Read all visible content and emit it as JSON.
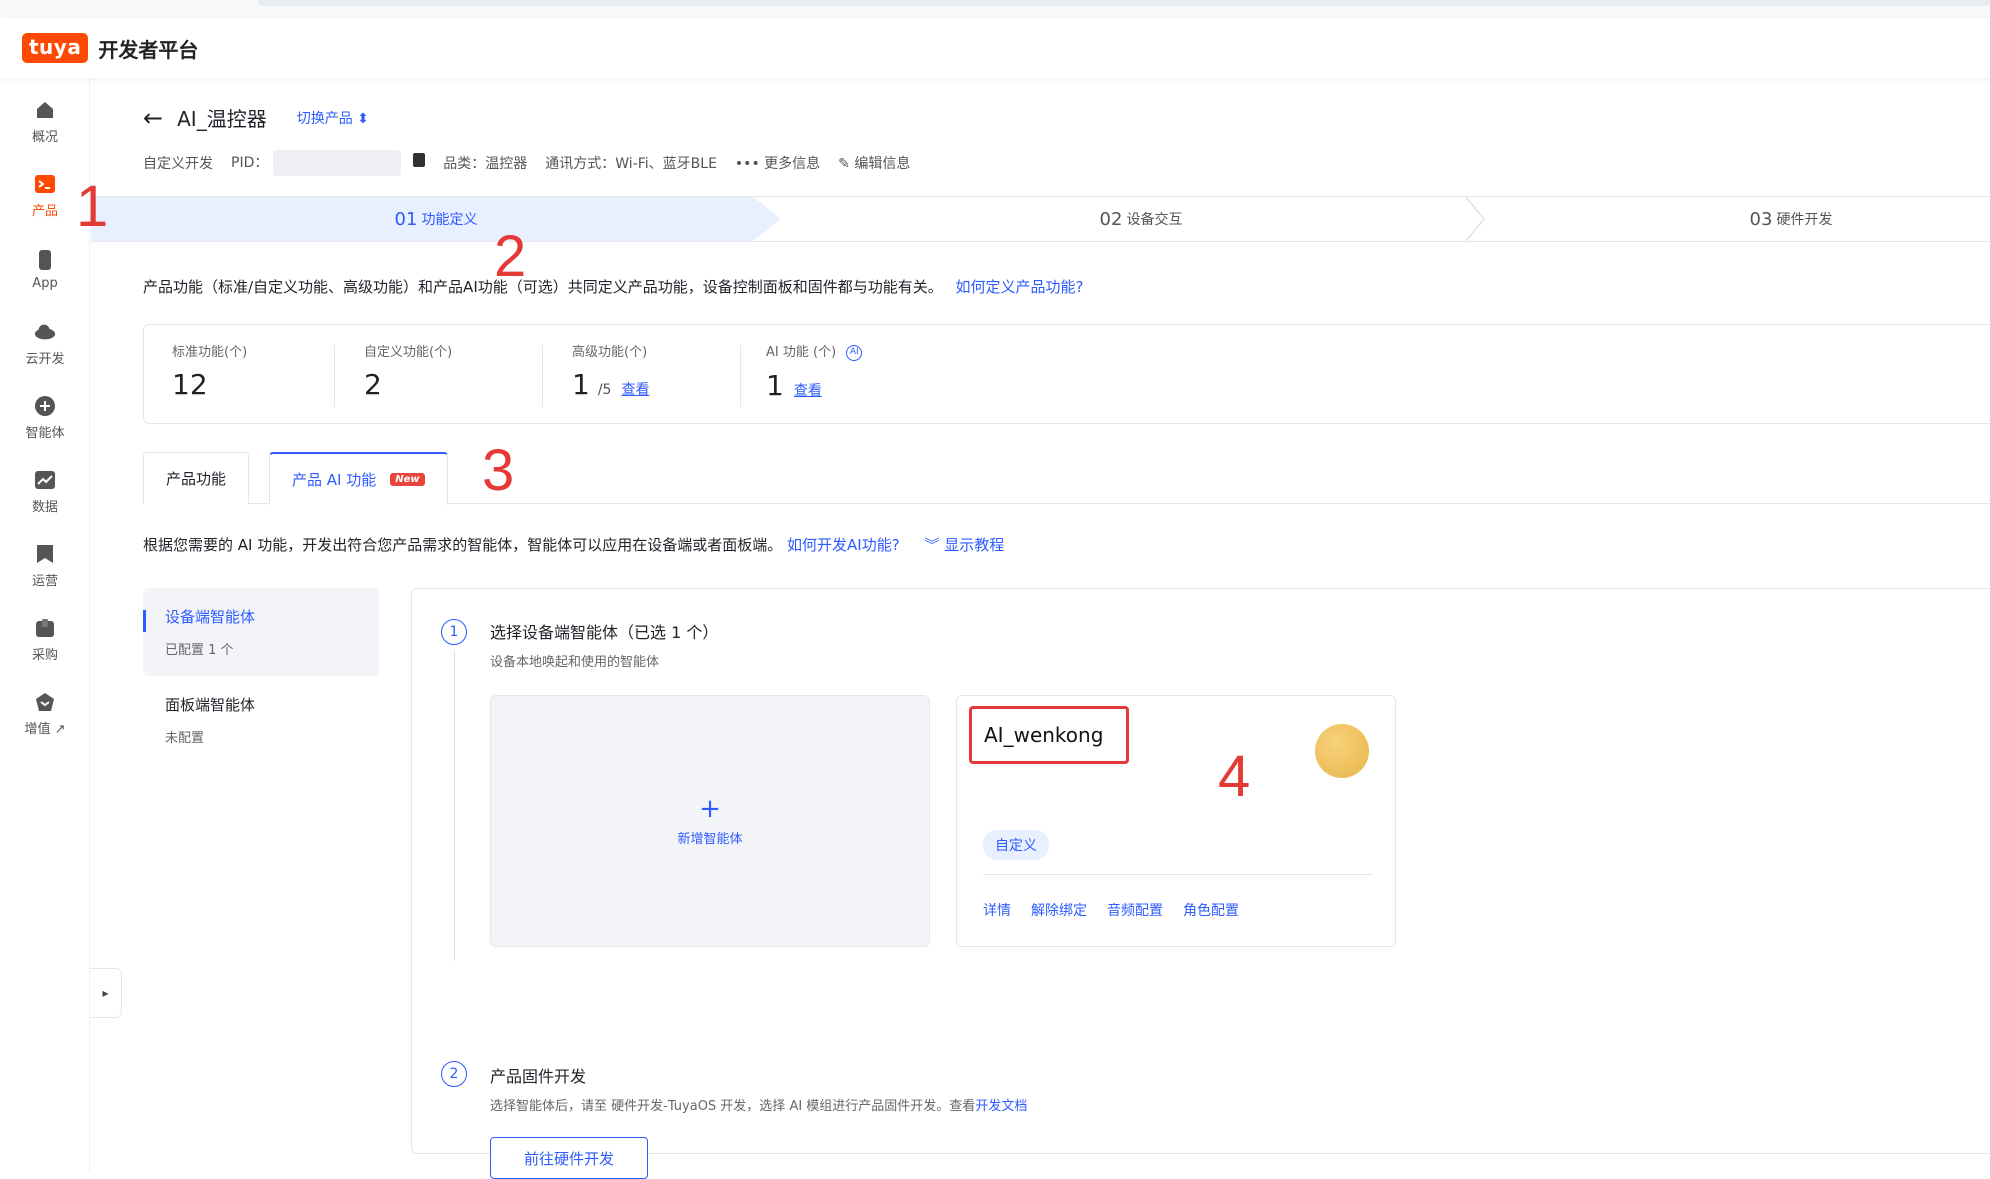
{
  "header": {
    "logo_text": "tuya",
    "brand": "开发者平台",
    "brand_color": "#ff4800"
  },
  "sidebar": {
    "items": [
      {
        "label": "概况",
        "icon": "home-icon"
      },
      {
        "label": "产品",
        "icon": "terminal-icon",
        "active": true
      },
      {
        "label": "App",
        "icon": "phone-icon"
      },
      {
        "label": "云开发",
        "icon": "cloud-icon"
      },
      {
        "label": "智能体",
        "icon": "agent-icon"
      },
      {
        "label": "数据",
        "icon": "chart-icon"
      },
      {
        "label": "运营",
        "icon": "bookmark-icon"
      },
      {
        "label": "采购",
        "icon": "box-icon"
      },
      {
        "label": "增值 ↗",
        "icon": "value-added-icon"
      }
    ],
    "collapse_glyph": "▸"
  },
  "product": {
    "back_glyph": "←",
    "title": "AI_温控器",
    "switch_label": "切换产品 ⬍",
    "mode": "自定义开发",
    "pid_label": "PID：",
    "category": "品类：温控器",
    "comm": "通讯方式：Wi-Fi、蓝牙BLE",
    "more": "••• 更多信息",
    "edit": "✎ 编辑信息"
  },
  "steps": [
    {
      "num": "01",
      "label": "功能定义",
      "active": true
    },
    {
      "num": "02",
      "label": "设备交互"
    },
    {
      "num": "03",
      "label": "硬件开发"
    }
  ],
  "desc": {
    "text": "产品功能（标准/自定义功能、高级功能）和产品AI功能（可选）共同定义产品功能，设备控制面板和固件都与功能有关。",
    "link": "如何定义产品功能?"
  },
  "stats": [
    {
      "label": "标准功能(个)",
      "value": "12"
    },
    {
      "label": "自定义功能(个)",
      "value": "2"
    },
    {
      "label": "高级功能(个)",
      "value": "1",
      "suffix": "/5",
      "link": "查看"
    },
    {
      "label": "AI 功能 (个)",
      "value": "1",
      "link": "查看",
      "badge": "AI"
    }
  ],
  "tabs": [
    {
      "label": "产品功能"
    },
    {
      "label": "产品 AI 功能",
      "badge": "New",
      "active": true
    }
  ],
  "desc2": {
    "text": "根据您需要的 AI 功能，开发出符合您产品需求的智能体，智能体可以应用在设备端或者面板端。",
    "link": "如何开发AI功能?",
    "toggle": "︾ 显示教程"
  },
  "left_menu": [
    {
      "title": "设备端智能体",
      "sub": "已配置 1 个",
      "active": true
    },
    {
      "title": "面板端智能体",
      "sub": "未配置"
    }
  ],
  "panel": {
    "step1": {
      "num": "1",
      "title": "选择设备端智能体（已选 1 个）",
      "sub": "设备本地唤起和使用的智能体"
    },
    "add_card": {
      "plus": "+",
      "label": "新增智能体"
    },
    "agent": {
      "name": "AI_wenkong",
      "tag": "自定义",
      "actions": [
        "详情",
        "解除绑定",
        "音频配置",
        "角色配置"
      ]
    },
    "step2": {
      "num": "2",
      "title": "产品固件开发",
      "sub": "选择智能体后，请至 硬件开发-TuyaOS 开发，选择 AI 模组进行产品固件开发。查看",
      "sub_link": "开发文档",
      "button": "前往硬件开发"
    }
  },
  "annotations": [
    "1",
    "2",
    "3",
    "4"
  ],
  "colors": {
    "accent": "#2e5bff",
    "annotation": "#e53935"
  }
}
